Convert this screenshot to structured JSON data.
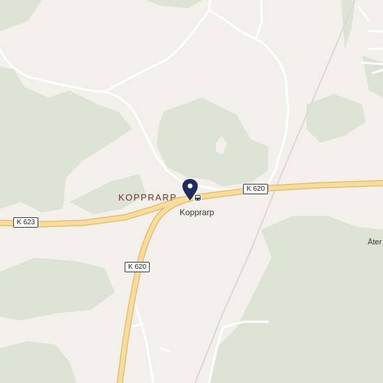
{
  "map": {
    "place_label": "KOPPRARP",
    "poi": {
      "name": "Kopprarp",
      "icon": "bus-stop-icon"
    },
    "marker": {
      "icon": "location-pin-icon",
      "color": "#1f2d5c"
    },
    "roads": [
      {
        "label": "K 620"
      },
      {
        "label": "K 623"
      },
      {
        "label": "K 620"
      }
    ],
    "edge_label": "Åter",
    "colors": {
      "land": "#f3efea",
      "forest": "#dde4d6",
      "major_road": "#f3d28d",
      "major_road_casing": "#e7be6e",
      "minor_road": "#ffffff",
      "rail": "#d9d6d2"
    }
  }
}
